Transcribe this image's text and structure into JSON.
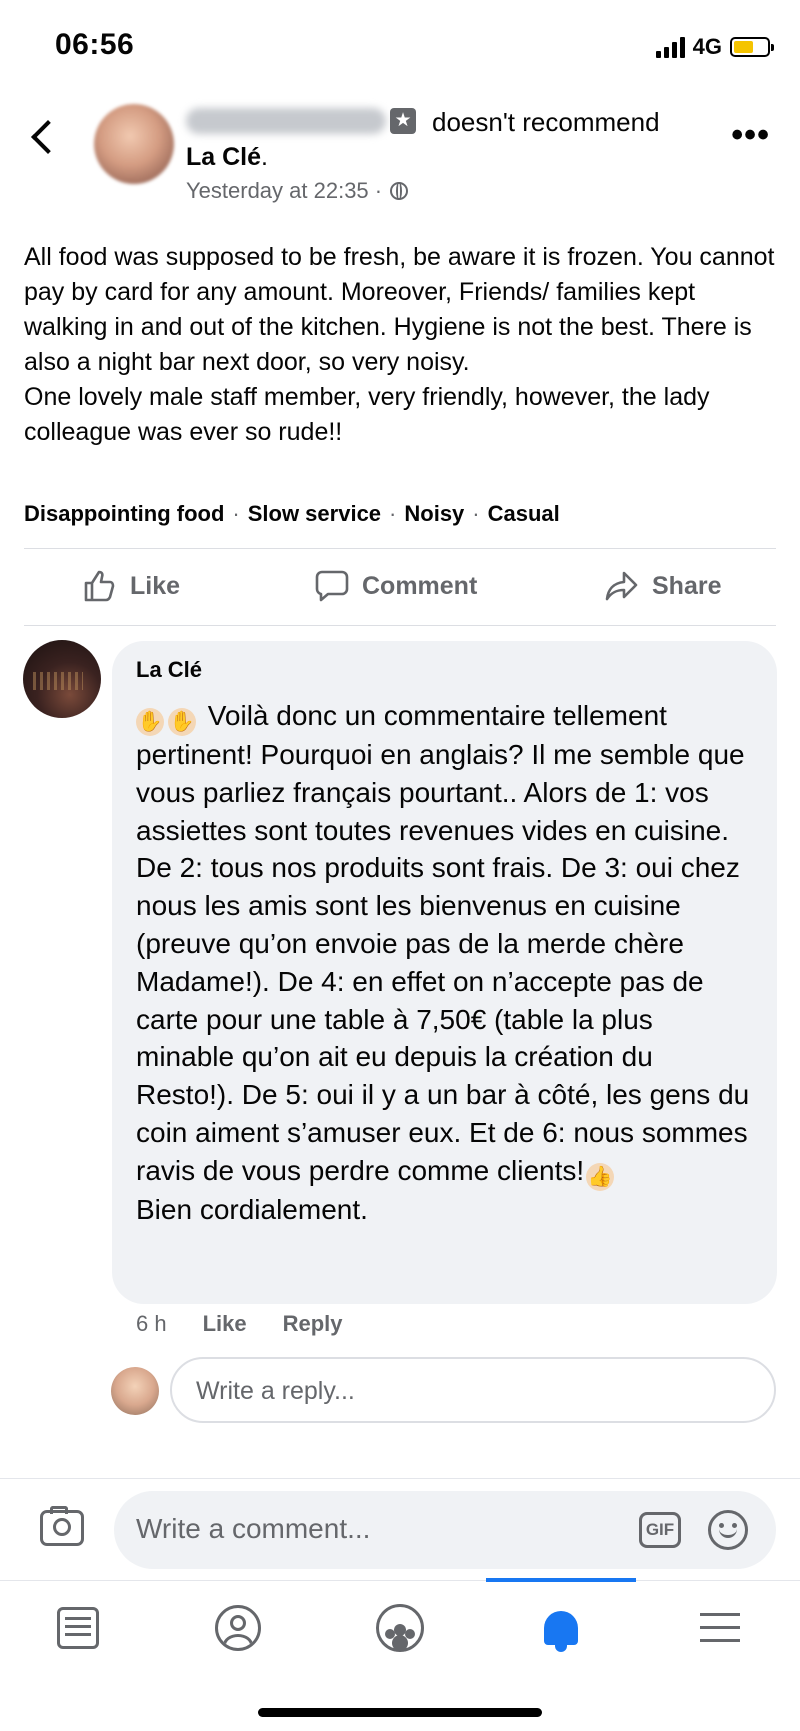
{
  "status_bar": {
    "time": "06:56",
    "network": "4G"
  },
  "post": {
    "recommendation": "doesn't recommend",
    "place": "La Clé",
    "place_suffix": ".",
    "timestamp": "Yesterday at 22:35 ·",
    "body_lines": [
      "All food was supposed to be fresh, be aware it is frozen. You cannot pay by card for any amount. Moreover, Friends/ families kept walking in and out of the kitchen. Hygiene is not the best. There is also a night bar next door, so very noisy.",
      "One lovely male staff member, very friendly, however, the lady colleague was ever so rude!!"
    ],
    "tags": [
      "Disappointing food",
      "Slow service",
      "Noisy",
      "Casual"
    ],
    "tag_separator": "·"
  },
  "actions": {
    "like": "Like",
    "comment": "Comment",
    "share": "Share"
  },
  "comment": {
    "author": "La Clé",
    "text_main": "Voilà donc un commentaire tellement pertinent! Pourquoi en anglais? Il me semble que vous parliez français pourtant.. Alors de 1: vos assiettes sont toutes revenues vides en cuisine. De 2: tous nos produits sont frais. De 3: oui chez nous les amis sont les bienvenus en cuisine (preuve qu’on envoie pas de la merde chère Madame!). De 4: en effet on n’accepte pas de carte pour une table à 7,50€ (table la plus minable qu’on ait eu depuis la création du Resto!). De 5: oui il y a un bar à côté, les gens du coin aiment s’amuser eux. Et de 6: nous sommes ravis de vous perdre comme clients!",
    "text_signoff": "Bien cordialement.",
    "time": "6 h",
    "like": "Like",
    "reply": "Reply"
  },
  "reply_input": {
    "placeholder": "Write a reply..."
  },
  "comment_input": {
    "placeholder": "Write a comment...",
    "gif_label": "GIF"
  },
  "bottom_nav": {
    "items": [
      "feed-icon",
      "profile-icon",
      "groups-icon",
      "notifications-icon",
      "menu-icon"
    ],
    "active": "notifications-icon",
    "accent": "#1877f2"
  }
}
